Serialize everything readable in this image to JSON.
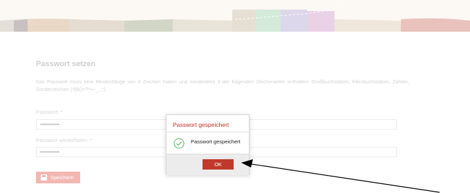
{
  "page": {
    "title": "Passwort setzen",
    "description": "Das Passwort muss eine Mindestlänge von 8 Zeichen haben und mindestens 3 der folgenden Zeichenarten enthalten: Großbuchstaben, Kleinbuchstaben, Zahlen, Sonderzeichen (!§$()=?*+~_.,:;)"
  },
  "form": {
    "password_label": "Passwort: *",
    "password_value": "••••••••••••",
    "repeat_label": "Passwort wiederholen: *",
    "repeat_value": "••••••••••••",
    "save_label": "Speichern"
  },
  "dialog": {
    "title": "Passwort gespeichert",
    "message": "Passwort gespeichert",
    "ok_label": "OK",
    "icon": "check-circle-icon"
  },
  "colors": {
    "accent": "#c0392b",
    "save_button_disabled": "#f3b7b2"
  }
}
